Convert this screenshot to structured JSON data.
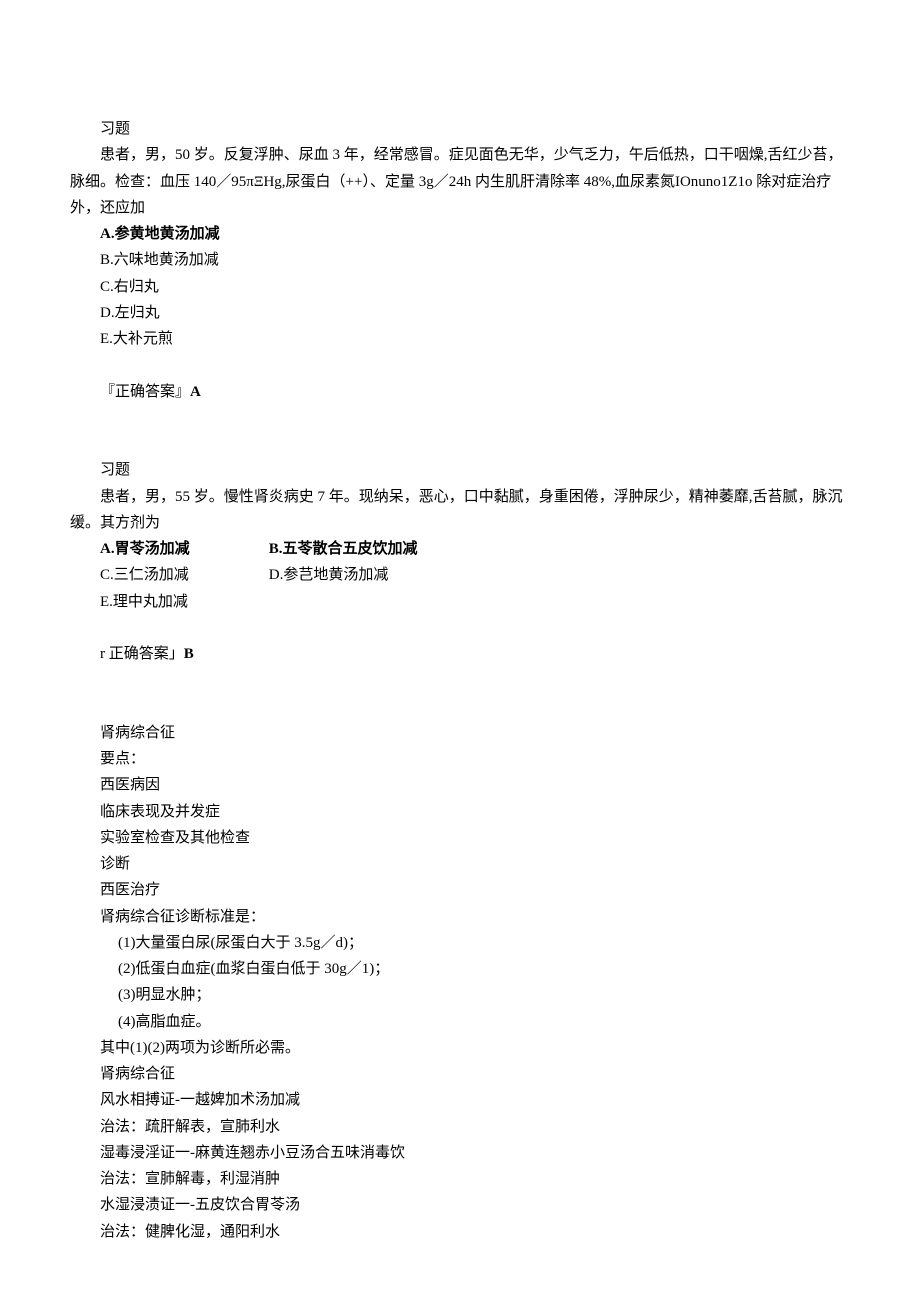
{
  "q1": {
    "label": "习题",
    "body1": "患者，男，50 岁。反复浮肿、尿血 3 年，经常感冒。症见面色无华，少气乏力，午后低热，口干咽燥,舌红少苔，脉细。检查：血压 140／95πΞHg,尿蛋白（++）、定量 3g／24h 内生肌肝清除率 48%,血尿素氮IOnuno1Z1o 除对症治疗外，还应加",
    "a": "A.参黄地黄汤加减",
    "b": "B.六味地黄汤加减",
    "c": "C.右归丸",
    "d": "D.左归丸",
    "e": "E.大补元煎",
    "ans_label": "『正确答案』",
    "ans": "A"
  },
  "q2": {
    "label": "习题",
    "body1": "患者，男，55 岁。慢性肾炎病史 7 年。现纳呆，恶心，口中黏腻，身重困倦，浮肿尿少，精神萎靡,舌苔腻，脉沉缓。其方剂为",
    "a": "A.胃苓汤加减",
    "b": "B.五苓散合五皮饮加减",
    "c": "C.三仁汤加减",
    "d": "D.参芑地黄汤加减",
    "e": "E.理中丸加减",
    "ans_label": "r 正确答案」",
    "ans": "B"
  },
  "section": {
    "title": "肾病综合征",
    "points_label": "要点：",
    "p1": "西医病因",
    "p2": "临床表现及并发症",
    "p3": "实验室检查及其他检查",
    "p4": "诊断",
    "p5": "西医治疗",
    "diag_label": "肾病综合征诊断标准是：",
    "d1": "(1)大量蛋白尿(尿蛋白大于 3.5g／d)；",
    "d2": "(2)低蛋白血症(血浆白蛋白低于 30g／1)；",
    "d3": "(3)明显水肿；",
    "d4": "(4)高脂血症。",
    "diag_note": "其中(1)(2)两项为诊断所必需。",
    "title2": "肾病综合征",
    "r1": "风水相搏证-一越婢加术汤加减",
    "r1t": "治法：疏肝解表，宣肺利水",
    "r2": "湿毒浸淫证一-麻黄连翘赤小豆汤合五味消毒饮",
    "r2t": "治法：宣肺解毒，利湿消肿",
    "r3": "水湿浸渍证一-五皮饮合胃苓汤",
    "r3t": "治法：健脾化湿，通阳利水"
  }
}
